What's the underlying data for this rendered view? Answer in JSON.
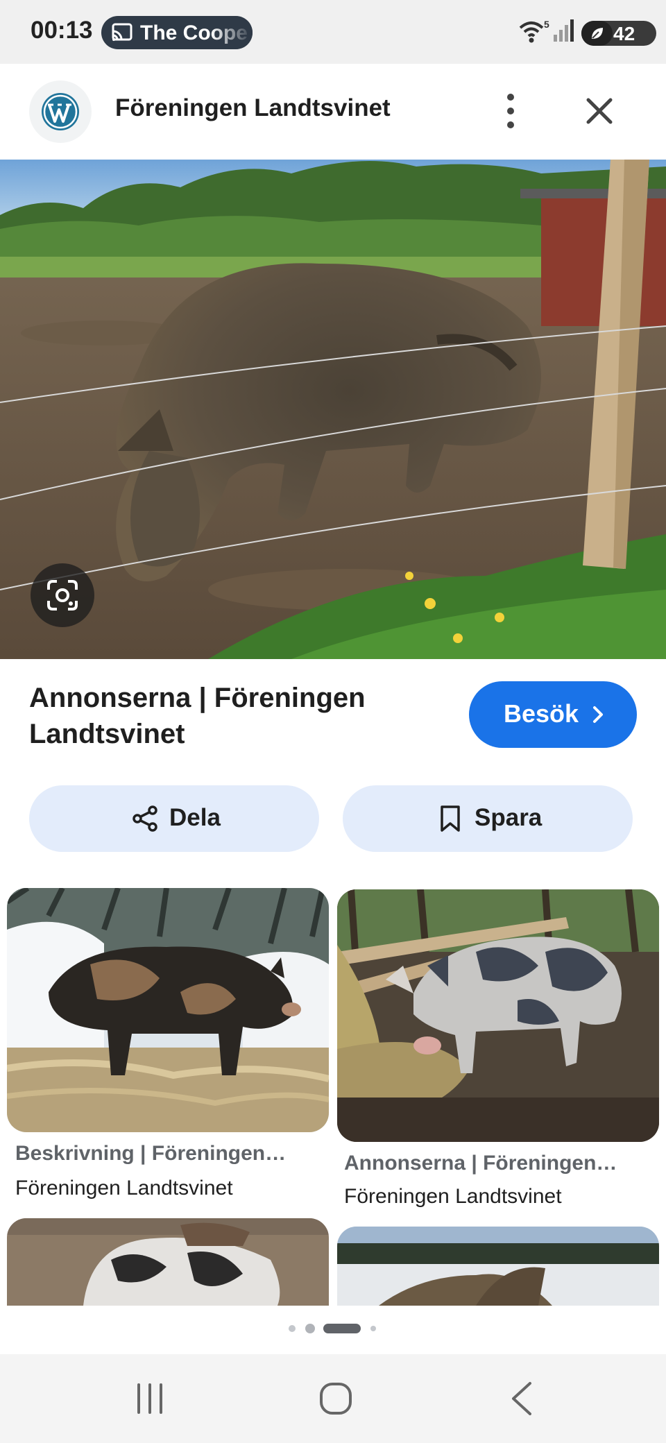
{
  "status_bar": {
    "time": "00:13",
    "cast_text": "The Coope",
    "wifi_badge": "5",
    "battery": 42,
    "battery_label": "42"
  },
  "header": {
    "site_title": "Föreningen Landtsvinet",
    "logo_icon": "wordpress-icon",
    "more_icon": "more-vertical-icon",
    "close_icon": "close-icon"
  },
  "result": {
    "title": "Annonserna | Föreningen Landtsvinet",
    "visit_label": "Besök",
    "share_label": "Dela",
    "save_label": "Spara"
  },
  "grid": [
    {
      "caption": "Beskrivning | Föreningen…",
      "source": "Föreningen Landtsvinet"
    },
    {
      "caption": "Annonserna | Föreningen…",
      "source": "Föreningen Landtsvinet"
    }
  ],
  "pager": {
    "count": 4,
    "active": 2
  },
  "colors": {
    "accent": "#1a73e8",
    "action_bg": "#e3ecfb",
    "status_bg": "#f0f0f0"
  }
}
